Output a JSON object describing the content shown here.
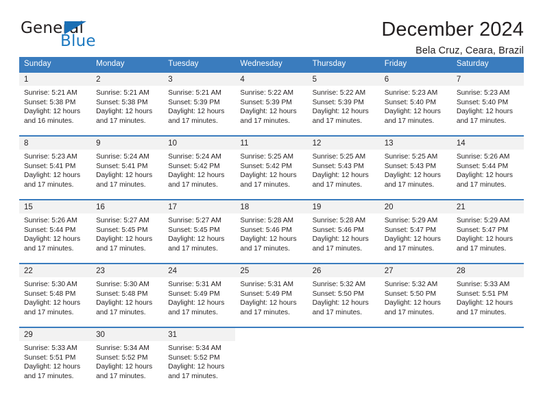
{
  "brand": {
    "name_part1": "General",
    "name_part2": "Blue",
    "accent_color": "#1f7ac0"
  },
  "header": {
    "title": "December 2024",
    "subtitle": "Bela Cruz, Ceara, Brazil"
  },
  "calendar": {
    "header_bg": "#3a7cbe",
    "daynum_bg": "#f2f2f2",
    "weekdays": [
      "Sunday",
      "Monday",
      "Tuesday",
      "Wednesday",
      "Thursday",
      "Friday",
      "Saturday"
    ],
    "weeks": [
      [
        {
          "day": "1",
          "sunrise": "Sunrise: 5:21 AM",
          "sunset": "Sunset: 5:38 PM",
          "daylight1": "Daylight: 12 hours",
          "daylight2": "and 16 minutes."
        },
        {
          "day": "2",
          "sunrise": "Sunrise: 5:21 AM",
          "sunset": "Sunset: 5:38 PM",
          "daylight1": "Daylight: 12 hours",
          "daylight2": "and 17 minutes."
        },
        {
          "day": "3",
          "sunrise": "Sunrise: 5:21 AM",
          "sunset": "Sunset: 5:39 PM",
          "daylight1": "Daylight: 12 hours",
          "daylight2": "and 17 minutes."
        },
        {
          "day": "4",
          "sunrise": "Sunrise: 5:22 AM",
          "sunset": "Sunset: 5:39 PM",
          "daylight1": "Daylight: 12 hours",
          "daylight2": "and 17 minutes."
        },
        {
          "day": "5",
          "sunrise": "Sunrise: 5:22 AM",
          "sunset": "Sunset: 5:39 PM",
          "daylight1": "Daylight: 12 hours",
          "daylight2": "and 17 minutes."
        },
        {
          "day": "6",
          "sunrise": "Sunrise: 5:23 AM",
          "sunset": "Sunset: 5:40 PM",
          "daylight1": "Daylight: 12 hours",
          "daylight2": "and 17 minutes."
        },
        {
          "day": "7",
          "sunrise": "Sunrise: 5:23 AM",
          "sunset": "Sunset: 5:40 PM",
          "daylight1": "Daylight: 12 hours",
          "daylight2": "and 17 minutes."
        }
      ],
      [
        {
          "day": "8",
          "sunrise": "Sunrise: 5:23 AM",
          "sunset": "Sunset: 5:41 PM",
          "daylight1": "Daylight: 12 hours",
          "daylight2": "and 17 minutes."
        },
        {
          "day": "9",
          "sunrise": "Sunrise: 5:24 AM",
          "sunset": "Sunset: 5:41 PM",
          "daylight1": "Daylight: 12 hours",
          "daylight2": "and 17 minutes."
        },
        {
          "day": "10",
          "sunrise": "Sunrise: 5:24 AM",
          "sunset": "Sunset: 5:42 PM",
          "daylight1": "Daylight: 12 hours",
          "daylight2": "and 17 minutes."
        },
        {
          "day": "11",
          "sunrise": "Sunrise: 5:25 AM",
          "sunset": "Sunset: 5:42 PM",
          "daylight1": "Daylight: 12 hours",
          "daylight2": "and 17 minutes."
        },
        {
          "day": "12",
          "sunrise": "Sunrise: 5:25 AM",
          "sunset": "Sunset: 5:43 PM",
          "daylight1": "Daylight: 12 hours",
          "daylight2": "and 17 minutes."
        },
        {
          "day": "13",
          "sunrise": "Sunrise: 5:25 AM",
          "sunset": "Sunset: 5:43 PM",
          "daylight1": "Daylight: 12 hours",
          "daylight2": "and 17 minutes."
        },
        {
          "day": "14",
          "sunrise": "Sunrise: 5:26 AM",
          "sunset": "Sunset: 5:44 PM",
          "daylight1": "Daylight: 12 hours",
          "daylight2": "and 17 minutes."
        }
      ],
      [
        {
          "day": "15",
          "sunrise": "Sunrise: 5:26 AM",
          "sunset": "Sunset: 5:44 PM",
          "daylight1": "Daylight: 12 hours",
          "daylight2": "and 17 minutes."
        },
        {
          "day": "16",
          "sunrise": "Sunrise: 5:27 AM",
          "sunset": "Sunset: 5:45 PM",
          "daylight1": "Daylight: 12 hours",
          "daylight2": "and 17 minutes."
        },
        {
          "day": "17",
          "sunrise": "Sunrise: 5:27 AM",
          "sunset": "Sunset: 5:45 PM",
          "daylight1": "Daylight: 12 hours",
          "daylight2": "and 17 minutes."
        },
        {
          "day": "18",
          "sunrise": "Sunrise: 5:28 AM",
          "sunset": "Sunset: 5:46 PM",
          "daylight1": "Daylight: 12 hours",
          "daylight2": "and 17 minutes."
        },
        {
          "day": "19",
          "sunrise": "Sunrise: 5:28 AM",
          "sunset": "Sunset: 5:46 PM",
          "daylight1": "Daylight: 12 hours",
          "daylight2": "and 17 minutes."
        },
        {
          "day": "20",
          "sunrise": "Sunrise: 5:29 AM",
          "sunset": "Sunset: 5:47 PM",
          "daylight1": "Daylight: 12 hours",
          "daylight2": "and 17 minutes."
        },
        {
          "day": "21",
          "sunrise": "Sunrise: 5:29 AM",
          "sunset": "Sunset: 5:47 PM",
          "daylight1": "Daylight: 12 hours",
          "daylight2": "and 17 minutes."
        }
      ],
      [
        {
          "day": "22",
          "sunrise": "Sunrise: 5:30 AM",
          "sunset": "Sunset: 5:48 PM",
          "daylight1": "Daylight: 12 hours",
          "daylight2": "and 17 minutes."
        },
        {
          "day": "23",
          "sunrise": "Sunrise: 5:30 AM",
          "sunset": "Sunset: 5:48 PM",
          "daylight1": "Daylight: 12 hours",
          "daylight2": "and 17 minutes."
        },
        {
          "day": "24",
          "sunrise": "Sunrise: 5:31 AM",
          "sunset": "Sunset: 5:49 PM",
          "daylight1": "Daylight: 12 hours",
          "daylight2": "and 17 minutes."
        },
        {
          "day": "25",
          "sunrise": "Sunrise: 5:31 AM",
          "sunset": "Sunset: 5:49 PM",
          "daylight1": "Daylight: 12 hours",
          "daylight2": "and 17 minutes."
        },
        {
          "day": "26",
          "sunrise": "Sunrise: 5:32 AM",
          "sunset": "Sunset: 5:50 PM",
          "daylight1": "Daylight: 12 hours",
          "daylight2": "and 17 minutes."
        },
        {
          "day": "27",
          "sunrise": "Sunrise: 5:32 AM",
          "sunset": "Sunset: 5:50 PM",
          "daylight1": "Daylight: 12 hours",
          "daylight2": "and 17 minutes."
        },
        {
          "day": "28",
          "sunrise": "Sunrise: 5:33 AM",
          "sunset": "Sunset: 5:51 PM",
          "daylight1": "Daylight: 12 hours",
          "daylight2": "and 17 minutes."
        }
      ],
      [
        {
          "day": "29",
          "sunrise": "Sunrise: 5:33 AM",
          "sunset": "Sunset: 5:51 PM",
          "daylight1": "Daylight: 12 hours",
          "daylight2": "and 17 minutes."
        },
        {
          "day": "30",
          "sunrise": "Sunrise: 5:34 AM",
          "sunset": "Sunset: 5:52 PM",
          "daylight1": "Daylight: 12 hours",
          "daylight2": "and 17 minutes."
        },
        {
          "day": "31",
          "sunrise": "Sunrise: 5:34 AM",
          "sunset": "Sunset: 5:52 PM",
          "daylight1": "Daylight: 12 hours",
          "daylight2": "and 17 minutes."
        },
        {
          "day": "",
          "sunrise": "",
          "sunset": "",
          "daylight1": "",
          "daylight2": ""
        },
        {
          "day": "",
          "sunrise": "",
          "sunset": "",
          "daylight1": "",
          "daylight2": ""
        },
        {
          "day": "",
          "sunrise": "",
          "sunset": "",
          "daylight1": "",
          "daylight2": ""
        },
        {
          "day": "",
          "sunrise": "",
          "sunset": "",
          "daylight1": "",
          "daylight2": ""
        }
      ]
    ]
  }
}
